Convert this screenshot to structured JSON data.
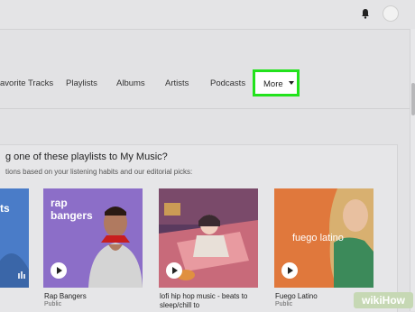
{
  "tabs": [
    {
      "label": "avorite Tracks"
    },
    {
      "label": "Playlists"
    },
    {
      "label": "Albums"
    },
    {
      "label": "Artists"
    },
    {
      "label": "Podcasts"
    }
  ],
  "more_button": {
    "label": "More"
  },
  "section": {
    "heading": "g one of these playlists to My Music?",
    "subheading": "tions based on your listening habits and our editorial picks:"
  },
  "tiles": [
    {
      "cover_text": "ts",
      "title": "",
      "subtitle": ""
    },
    {
      "cover_text_1": "rap",
      "cover_text_2": "bangers",
      "title": "Rap Bangers",
      "subtitle": "Public"
    },
    {
      "title": "lofi hip hop music - beats to",
      "title_2": "sleep/chill to",
      "subtitle": ""
    },
    {
      "cover_text": "fuego latino",
      "title": "Fuego Latino",
      "subtitle": "Public"
    }
  ],
  "watermark": "wikiHow",
  "colors": {
    "highlight": "#22e21c",
    "rap_cover": "#8c6ec8",
    "fuego_cover": "#e0783c",
    "partial_cover": "#4a7cc8"
  }
}
